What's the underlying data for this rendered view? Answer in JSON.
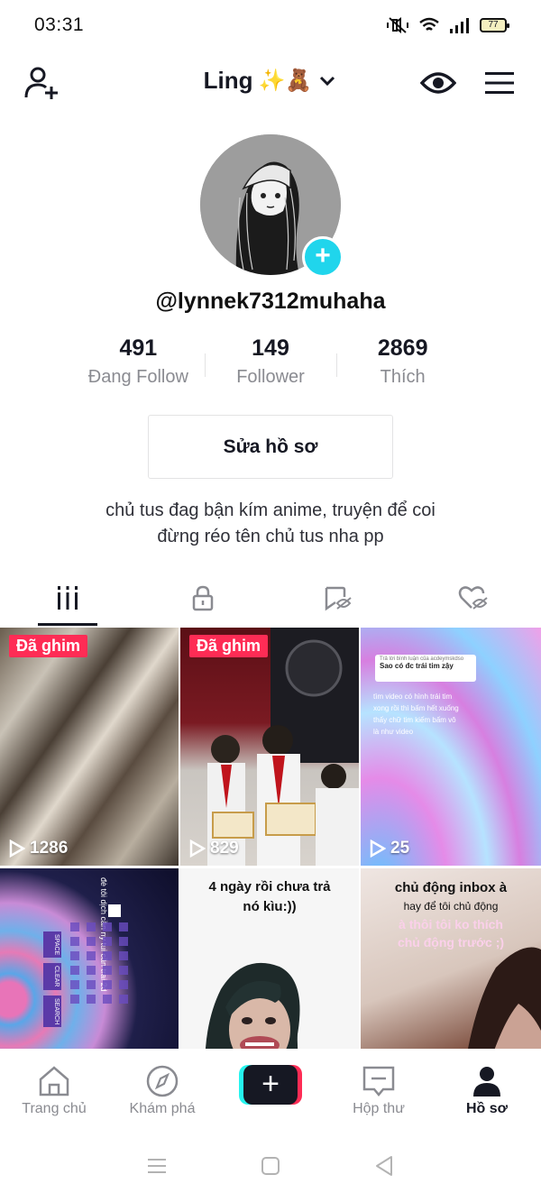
{
  "status_bar": {
    "time": "03:31",
    "battery": "77"
  },
  "header": {
    "profile_name": "Ling",
    "name_emoji": "✨🧸"
  },
  "profile": {
    "username": "@lynnek7312muhaha",
    "stats": [
      {
        "value": "491",
        "label": "Đang Follow"
      },
      {
        "value": "149",
        "label": "Follower"
      },
      {
        "value": "2869",
        "label": "Thích"
      }
    ],
    "edit_label": "Sửa hồ sơ",
    "bio_line1": "chủ tus đag bận kím anime, truyện để coi",
    "bio_line2": "đừng réo tên chủ tus nha pp"
  },
  "tabs": [
    "videos",
    "private",
    "favorites",
    "liked"
  ],
  "videos": [
    {
      "pinned_label": "Đã ghim",
      "views": "1286"
    },
    {
      "pinned_label": "Đã ghim",
      "views": "829"
    },
    {
      "views": "25",
      "reply_header": "Trả lời bình luận của acdeymskdso",
      "reply_text": "Sao có đc trái tim zậy",
      "caption": "tìm video có hình trái tim xong rồi thì bấm hết xuống thấy chữ tim kiếm bấm vô là như video"
    },
    {
      "caption_top": "đè tôi dịch cần ny tui cần trai 2d",
      "keys": [
        "SPACE",
        "CLEAR",
        "SEARCH"
      ]
    },
    {
      "overlay_line1": "4 ngày rồi chưa trả",
      "overlay_line2": "nó kìu:))"
    },
    {
      "overlay_line1": "chủ động inbox à",
      "overlay_line2": "hay để tôi chủ động",
      "overlay_line3": "à thôi tôi ko thích",
      "overlay_line4": "chủ động trước ;)"
    }
  ],
  "bottom_nav": [
    {
      "label": "Trang chủ"
    },
    {
      "label": "Khám phá"
    },
    {
      "label": ""
    },
    {
      "label": "Hộp thư"
    },
    {
      "label": "Hồ sơ"
    }
  ],
  "colors": {
    "accent_red": "#fe2c55",
    "accent_cyan": "#20d5ec",
    "text": "#161823",
    "muted": "#8a8b91"
  }
}
